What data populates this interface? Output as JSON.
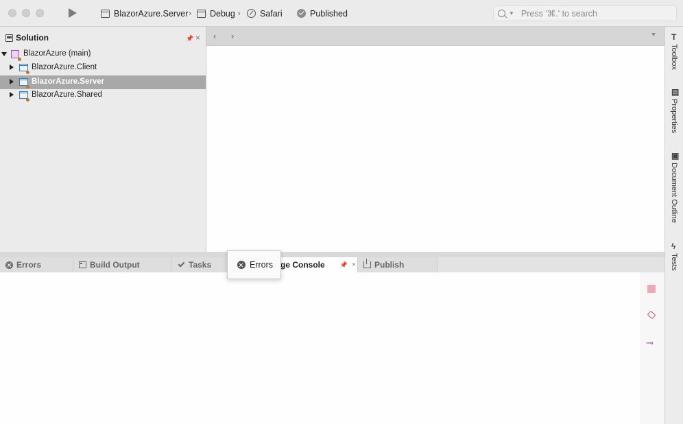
{
  "toolbar": {
    "project": "BlazorAzure.Server",
    "configuration": "Debug",
    "device": "Safari",
    "status": "Published",
    "search_placeholder": "Press '⌘.' to search",
    "chevron": "›"
  },
  "solution_pad": {
    "title": "Solution",
    "items": [
      {
        "label": "BlazorAzure (main)",
        "kind": "solution",
        "expanded": true
      },
      {
        "label": "BlazorAzure.Client",
        "kind": "project",
        "expanded": false
      },
      {
        "label": "BlazorAzure.Server",
        "kind": "project",
        "expanded": false,
        "selected": true
      },
      {
        "label": "BlazorAzure.Shared",
        "kind": "project",
        "expanded": false
      }
    ]
  },
  "editor": {
    "back": "‹",
    "forward": "›"
  },
  "side_bar": {
    "items": [
      {
        "label": "Toolbox",
        "icon": "T"
      },
      {
        "label": "Properties",
        "icon": "▤"
      },
      {
        "label": "Document Outline",
        "icon": "▣"
      },
      {
        "label": "Tests",
        "icon": "ϟ"
      }
    ]
  },
  "bottom_tabs": {
    "errors": "Errors",
    "build_output": "Build Output",
    "tasks": "Tasks",
    "package_console": "ge Console",
    "publish": "Publish"
  },
  "drag_tooltip": {
    "label": "Errors"
  },
  "colors": {
    "selection": "#a8a8a8",
    "solution_icon": "#9b4fb0",
    "project_icon": "#3a78b5",
    "stop": "#eba8b5"
  }
}
